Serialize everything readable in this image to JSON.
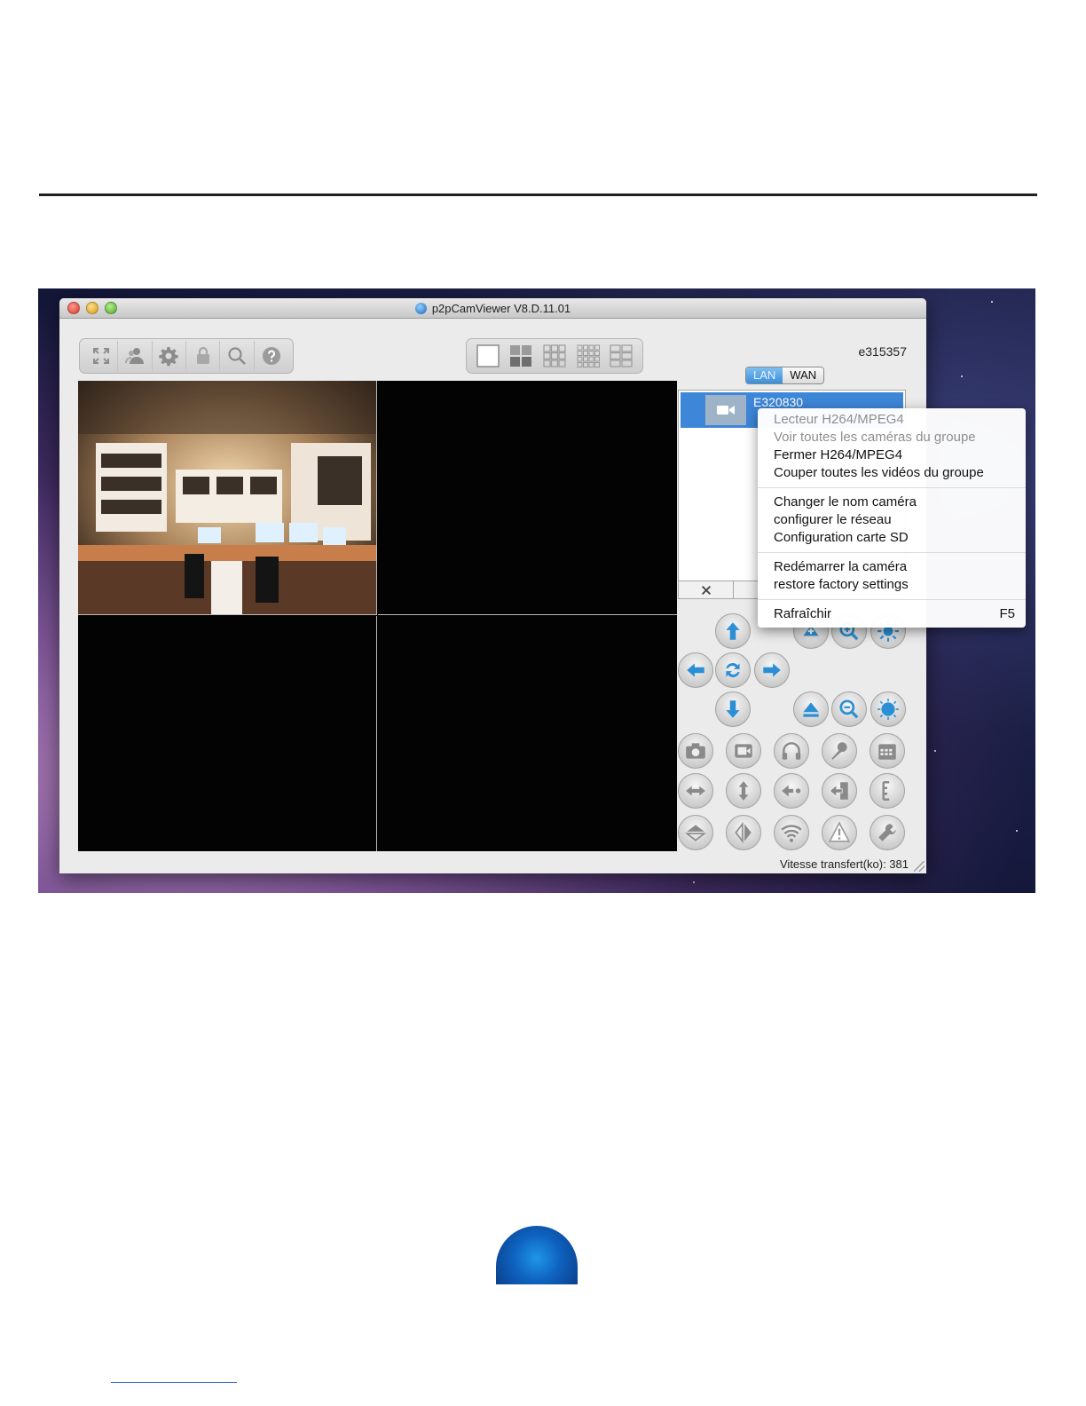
{
  "app": {
    "title": "p2pCamViewer V8.D.11.01",
    "camera_id": "e315357",
    "network_tabs": [
      "LAN",
      "WAN"
    ],
    "active_network_tab": "LAN"
  },
  "toolbar": {
    "icons": [
      "fullscreen-icon",
      "users-icon",
      "gear-icon",
      "lock-icon",
      "search-icon",
      "help-icon"
    ],
    "layouts": [
      "layout-1-icon",
      "layout-4-icon",
      "layout-9-icon",
      "layout-16-icon",
      "layout-6-icon"
    ]
  },
  "camera_list": {
    "items": [
      {
        "name": "E320830"
      }
    ],
    "delete_label": "✕"
  },
  "context_menu": {
    "group1": [
      {
        "label": "Lecteur H264/MPEG4",
        "disabled": true
      },
      {
        "label": "Voir toutes les caméras du groupe",
        "disabled": true
      },
      {
        "label": "Fermer H264/MPEG4",
        "disabled": false
      },
      {
        "label": "Couper toutes les vidéos du groupe",
        "disabled": false
      }
    ],
    "group2": [
      {
        "label": "Changer le nom caméra"
      },
      {
        "label": "configurer le réseau"
      },
      {
        "label": "Configuration carte SD"
      }
    ],
    "group3": [
      {
        "label": "Redémarrer la caméra"
      },
      {
        "label": "restore factory settings"
      }
    ],
    "refresh": {
      "label": "Rafraîchir",
      "shortcut": "F5"
    }
  },
  "status": {
    "transfer_label": "Vitesse transfert(ko): 381"
  },
  "colors": {
    "accent_blue": "#3d86d8",
    "ptz_icon_blue": "#2b8fd6",
    "video_background": "#030303"
  }
}
